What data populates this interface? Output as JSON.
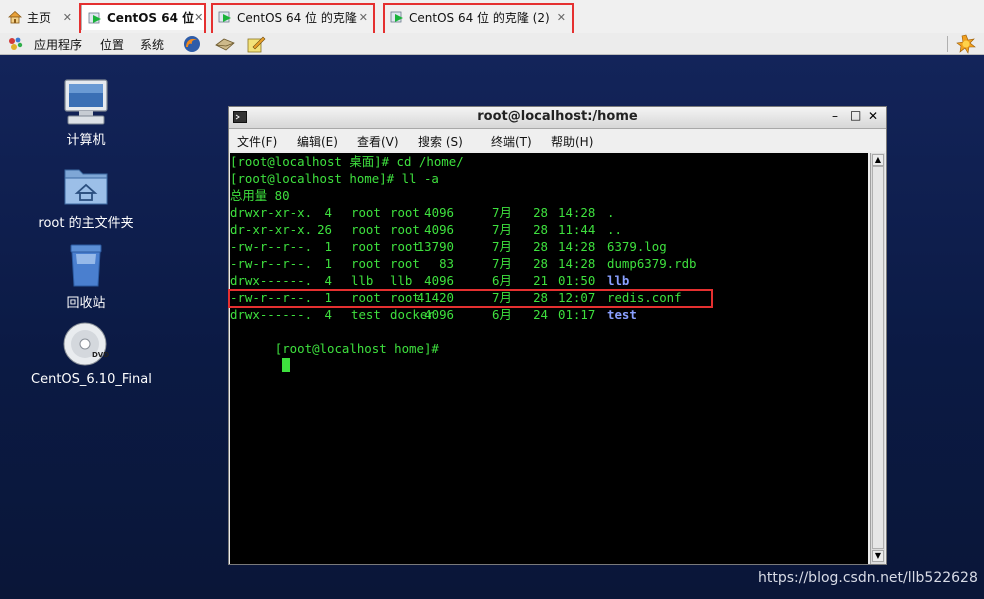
{
  "tabs": [
    {
      "label": "主页"
    },
    {
      "label": "CentOS 64 位"
    },
    {
      "label": "CentOS 64 位 的克隆"
    },
    {
      "label": "CentOS 64 位 的克隆 (2)"
    }
  ],
  "panel": {
    "apps": "应用程序",
    "places": "位置",
    "system": "系统"
  },
  "desktop_icons": [
    {
      "label": "计算机",
      "icon": "computer-icon"
    },
    {
      "label": "root 的主文件夹",
      "icon": "home-folder-icon"
    },
    {
      "label": "回收站",
      "icon": "trash-icon"
    },
    {
      "label": "CentOS_6.10_Final",
      "icon": "dvd-icon"
    }
  ],
  "terminal": {
    "title": "root@localhost:/home",
    "menu": [
      "文件(F)",
      "编辑(E)",
      "查看(V)",
      "搜索 (S)",
      "终端(T)",
      "帮助(H)"
    ],
    "lines": [
      "[root@localhost 桌面]# cd /home/",
      "[root@localhost home]# ll -a",
      "总用量 80"
    ],
    "entries": [
      {
        "perm": "drwxr-xr-x.",
        "links": "4",
        "owner": "root",
        "group": "root",
        "size": "4096",
        "month": "7月",
        "day": "28",
        "time": "14:28",
        "name": ".",
        "is_dir": false
      },
      {
        "perm": "dr-xr-xr-x.",
        "links": "26",
        "owner": "root",
        "group": "root",
        "size": "4096",
        "month": "7月",
        "day": "28",
        "time": "11:44",
        "name": "..",
        "is_dir": false
      },
      {
        "perm": "-rw-r--r--.",
        "links": "1",
        "owner": "root",
        "group": "root",
        "size": "13790",
        "month": "7月",
        "day": "28",
        "time": "14:28",
        "name": "6379.log",
        "is_dir": false
      },
      {
        "perm": "-rw-r--r--.",
        "links": "1",
        "owner": "root",
        "group": "root",
        "size": "83",
        "month": "7月",
        "day": "28",
        "time": "14:28",
        "name": "dump6379.rdb",
        "is_dir": false
      },
      {
        "perm": "drwx------.",
        "links": "4",
        "owner": "llb",
        "group": "llb",
        "size": "4096",
        "month": "6月",
        "day": "21",
        "time": "01:50",
        "name": "llb",
        "is_dir": true
      },
      {
        "perm": "-rw-r--r--.",
        "links": "1",
        "owner": "root",
        "group": "root",
        "size": "41420",
        "month": "7月",
        "day": "28",
        "time": "12:07",
        "name": "redis.conf",
        "is_dir": false
      },
      {
        "perm": "drwx------.",
        "links": "4",
        "owner": "test",
        "group": "docker",
        "size": "4096",
        "month": "6月",
        "day": "24",
        "time": "01:17",
        "name": "test",
        "is_dir": true
      }
    ],
    "prompt": "[root@localhost home]#"
  },
  "watermark": "https://blog.csdn.net/llb522628",
  "colors": {
    "terminal_text": "#3ee03e",
    "directory": "#8aa0ff",
    "highlight": "#e53030"
  }
}
